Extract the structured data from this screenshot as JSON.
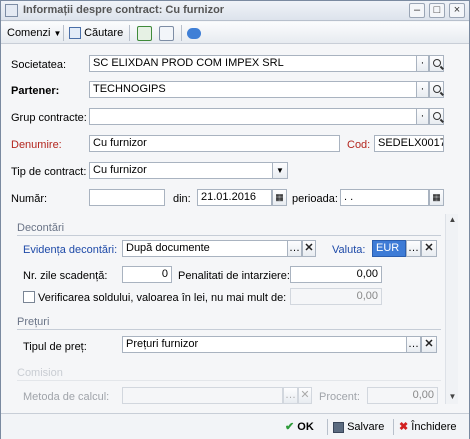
{
  "window": {
    "title": "Informații despre contract: Cu furnizor"
  },
  "toolbar": {
    "commands_label": "Comenzi",
    "search_label": "Căutare"
  },
  "form": {
    "societatea": {
      "label": "Societatea:",
      "value": "SC ELIXDAN PROD COM IMPEX SRL"
    },
    "partener": {
      "label": "Partener:",
      "value": "TECHNOGIPS"
    },
    "grup": {
      "label": "Grup contracte:",
      "value": ""
    },
    "denumire": {
      "label": "Denumire:",
      "value": "Cu furnizor"
    },
    "cod": {
      "label": "Cod:",
      "value": "SEDELX0017"
    },
    "tip": {
      "label": "Tip de contract:",
      "value": "Cu furnizor"
    },
    "numar": {
      "label": "Număr:",
      "value": ""
    },
    "din": {
      "label": "din:",
      "value": "21.01.2016"
    },
    "perioada": {
      "label": "perioada:",
      "value": ". ."
    }
  },
  "decontari": {
    "title": "Decontări",
    "evidenta": {
      "label": "Evidența decontări:",
      "value": "După documente"
    },
    "valuta": {
      "label": "Valuta:",
      "value": "EUR"
    },
    "zile": {
      "label": "Nr. zile scadență:",
      "value": "0"
    },
    "penalitati": {
      "label": "Penalitati de intarziere:",
      "value": "0,00"
    },
    "verificare": {
      "label": "Verificarea soldului, valoarea în lei, nu mai mult de:",
      "value": "0,00",
      "checked": false
    }
  },
  "preturi": {
    "title": "Prețuri",
    "tipul": {
      "label": "Tipul de preț:",
      "value": "Prețuri furnizor"
    }
  },
  "comision": {
    "title": "Comision",
    "metoda": {
      "label": "Metoda de calcul:",
      "value": ""
    },
    "procent": {
      "label": "Procent:",
      "value": "0,00"
    }
  },
  "footer": {
    "ok": "OK",
    "save": "Salvare",
    "close": "Închidere"
  },
  "colors": {
    "accent_red": "#b3261e",
    "link_blue": "#1e4aa8",
    "ok_green": "#2e9b3a",
    "close_red": "#d21f1f"
  }
}
